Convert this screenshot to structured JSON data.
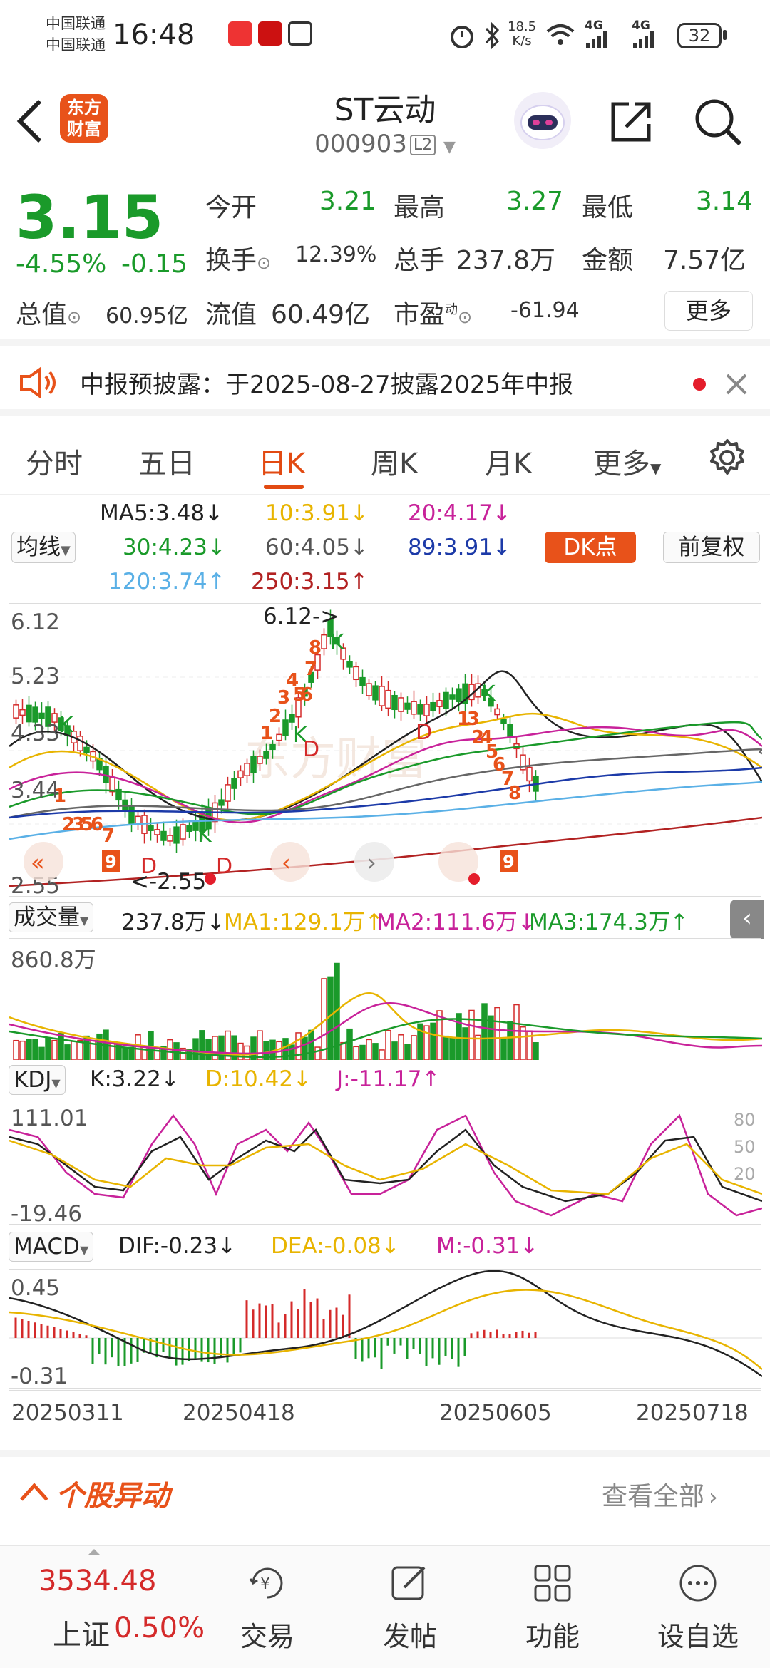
{
  "status_bar": {
    "carrier1": "中国联通",
    "carrier2": "中国联通",
    "time": "16:48",
    "net_speed_value": "18.5",
    "net_speed_unit": "K/s",
    "signal1": "4G",
    "signal2": "4G",
    "battery": "32"
  },
  "header": {
    "logo_line1": "东方",
    "logo_line2": "财富",
    "stock_name": "ST云动",
    "stock_code": "000903",
    "level_badge": "L2"
  },
  "quote": {
    "price": "3.15",
    "change_pct": "-4.55%",
    "change_amt": "-0.15",
    "open_label": "今开",
    "open": "3.21",
    "high_label": "最高",
    "high": "3.27",
    "low_label": "最低",
    "low": "3.14",
    "turnover_label": "换手",
    "turnover": "12.39%",
    "volume_label": "总手",
    "volume": "237.8万",
    "amount_label": "金额",
    "amount": "7.57亿",
    "mktcap_label": "总值",
    "mktcap": "60.95亿",
    "float_label": "流值",
    "float_cap": "60.49亿",
    "pe_label": "市盈",
    "pe_sup": "动",
    "pe": "-61.94",
    "more_button": "更多"
  },
  "notice": {
    "text": "中报预披露：于2025-08-27披露2025年中报"
  },
  "tabs": [
    "分时",
    "五日",
    "日K",
    "周K",
    "月K",
    "更多"
  ],
  "active_tab": "日K",
  "ma_legend": {
    "selector": "均线",
    "ma5": "MA5:3.48↓",
    "ma10": "10:3.91↓",
    "ma20": "20:4.17↓",
    "ma30": "30:4.23↓",
    "ma60": "60:4.05↓",
    "ma89": "89:3.91↓",
    "ma120": "120:3.74↑",
    "ma250": "250:3.15↑",
    "dk_button": "DK点",
    "adjust_button": "前复权"
  },
  "kline": {
    "y_top": "6.12",
    "y_2": "5.23",
    "y_3": "4.33",
    "y_4": "3.44",
    "y_bottom": "2.55",
    "max_annotation": "6.12->",
    "min_annotation": "<-2.55",
    "watermark": "东方财富"
  },
  "volume": {
    "selector": "成交量",
    "vol": "237.8万↓",
    "ma1": "MA1:129.1万↑",
    "ma2": "MA2:111.6万↓",
    "ma3": "MA3:174.3万↑",
    "y_top": "860.8万"
  },
  "kdj": {
    "selector": "KDJ",
    "k": "K:3.22↓",
    "d": "D:10.42↓",
    "j": "J:-11.17↑",
    "y_top": "111.01",
    "y_bottom": "-19.46",
    "ref80": "80",
    "ref50": "50",
    "ref20": "20"
  },
  "macd": {
    "selector": "MACD",
    "dif": "DIF:-0.23↓",
    "dea": "DEA:-0.08↓",
    "m": "M:-0.31↓",
    "y_top": "0.45",
    "y_bottom": "-0.31"
  },
  "dates": [
    "20250311",
    "20250418",
    "20250605",
    "20250718"
  ],
  "movers": {
    "title": "个股异动",
    "view_all": "查看全部"
  },
  "bottom_nav": {
    "index_value": "3534.48",
    "index_name": "上证",
    "index_change": "0.50%",
    "items": [
      "交易",
      "发帖",
      "功能",
      "设自选"
    ]
  },
  "colors": {
    "up": "#d42a2a",
    "down": "#1a9a2a",
    "accent": "#e24a12",
    "ma5": "#222222",
    "ma10": "#e8b400",
    "ma20": "#c8229a",
    "ma30": "#1a9a2a",
    "ma60": "#666666",
    "ma89": "#1c3aa8",
    "ma120": "#5ab0e6",
    "ma250": "#b22222"
  }
}
